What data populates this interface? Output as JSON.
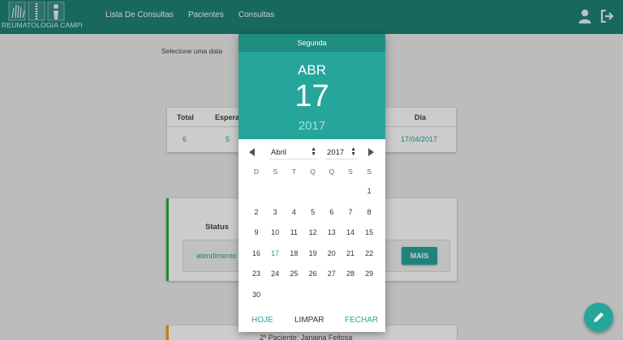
{
  "app": {
    "logo_text": "REUMATOLOGIA CAMPI",
    "nav": [
      "Lista De Consultas",
      "Pacientes",
      "Consultas"
    ],
    "icons": [
      "user-icon",
      "logout-icon"
    ],
    "accent": "#26a69a",
    "header_color": "#1f8277"
  },
  "page": {
    "select_label": "Selecione uma data",
    "stats": {
      "headers": [
        "Total",
        "Espera",
        "Dia"
      ],
      "values": [
        "6",
        "5",
        "17/04/2017"
      ]
    },
    "status": {
      "title": "Status",
      "value": "atendimento",
      "button": "MAIS",
      "border_color": "#1fae3a"
    },
    "next_patient": {
      "text": "2º Paciente: Janaina Feitosa",
      "border_color": "#e8a317"
    },
    "fab_icon": "pencil-icon"
  },
  "picker": {
    "weekday": "Segunda",
    "month_short": "ABR",
    "day": "17",
    "year": "2017",
    "month_select": "Abril",
    "year_select": "2017",
    "dow": [
      "D",
      "S",
      "T",
      "Q",
      "Q",
      "S",
      "S"
    ],
    "first_weekday": 6,
    "days_in_month": 30,
    "selected_day": 17,
    "footer": {
      "today": "HOJE",
      "clear": "LIMPAR",
      "close": "FECHAR"
    }
  }
}
